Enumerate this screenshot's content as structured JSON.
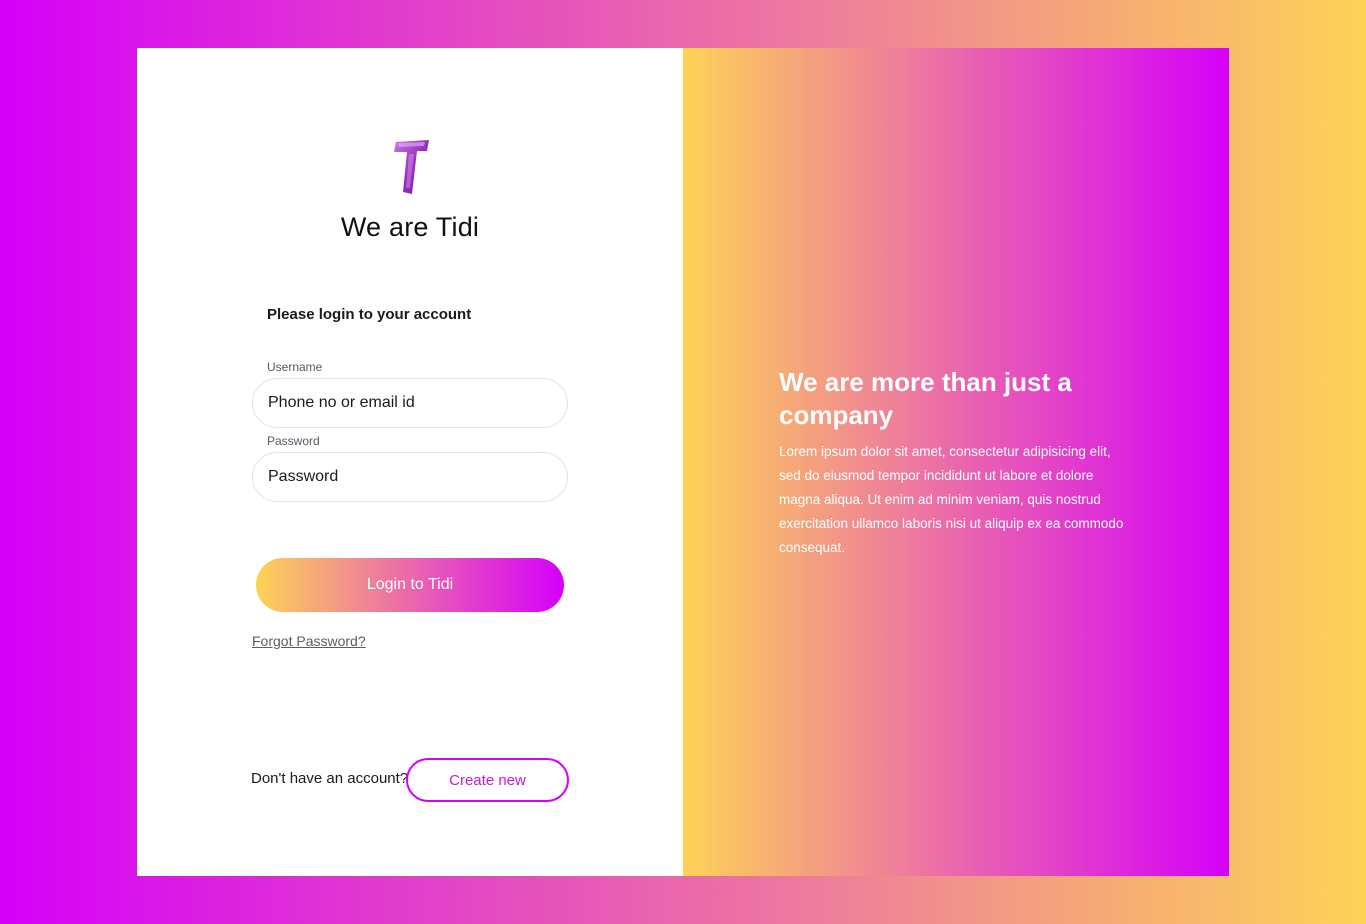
{
  "colors": {
    "gradient_magenta": "#d500fa",
    "gradient_pink": "#ea68ac",
    "gradient_yellow": "#fdd356",
    "card_background": "#ffffff"
  },
  "brand": {
    "logo_icon": "tidi-t-logo-icon",
    "title": "We are Tidi"
  },
  "login_form": {
    "prompt": "Please login to your account",
    "username_label": "Username",
    "username_placeholder": "Phone no or email id",
    "password_label": "Password",
    "password_placeholder": "Password",
    "submit_label": "Login to Tidi",
    "forgot_label": "Forgot Password?"
  },
  "signup": {
    "prompt": "Don't have an account?",
    "button_label": "Create new"
  },
  "promo": {
    "heading": "We are more than just a company",
    "body": "Lorem ipsum dolor sit amet, consectetur adipisicing elit, sed do eiusmod tempor incididunt ut labore et dolore magna aliqua. Ut enim ad minim veniam, quis nostrud exercitation ullamco laboris nisi ut aliquip ex ea commodo consequat."
  }
}
